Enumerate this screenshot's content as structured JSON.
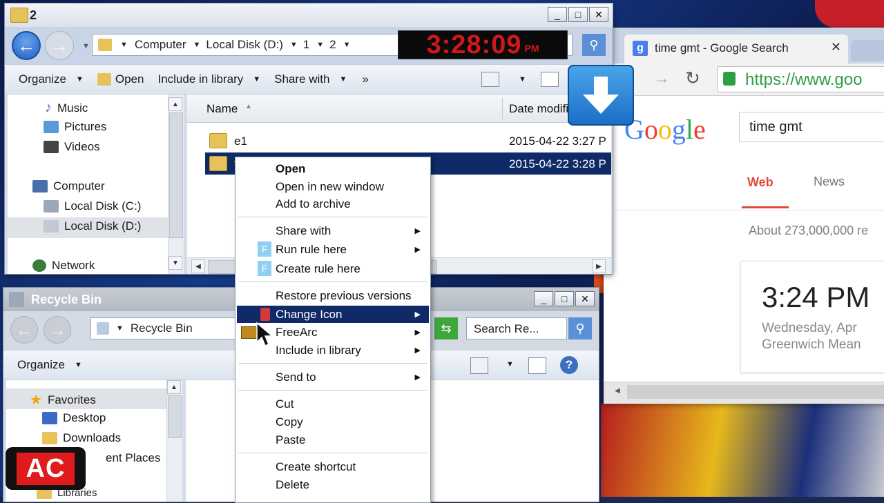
{
  "explorer": {
    "title": "2",
    "breadcrumb": [
      "Computer",
      "Local Disk (D:)",
      "1",
      "2"
    ],
    "commands": [
      "Organize",
      "Open",
      "Include in library",
      "Share with"
    ],
    "more": "»",
    "nav_items": [
      "Music",
      "Pictures",
      "Videos",
      "Computer",
      "Local Disk (C:)",
      "Local Disk (D:)",
      "Network"
    ],
    "columns": {
      "name": "Name",
      "date": "Date modifi"
    },
    "rows": [
      {
        "name": "e1",
        "date": "2015-04-22 3:27 P"
      },
      {
        "name": "t",
        "date": "2015-04-22 3:28 P"
      }
    ]
  },
  "clock": {
    "time": "3:28:09",
    "ampm": "PM"
  },
  "recycle": {
    "title": "Recycle Bin",
    "breadcrumb": "Recycle Bin",
    "search_placeholder": "Search Re...",
    "commands": [
      "Organize"
    ],
    "nav_items": [
      "Favorites",
      "Desktop",
      "Downloads",
      "ent Places",
      "Libraries"
    ]
  },
  "context_menu": {
    "items": [
      "Open",
      "Open in new window",
      "Add to archive",
      "Share with",
      "Run rule here",
      "Create rule here",
      "Restore previous versions",
      "Change Icon",
      "FreeArc",
      "Include in library",
      "Send to",
      "Cut",
      "Copy",
      "Paste",
      "Create shortcut",
      "Delete"
    ],
    "highlighted": "Change Icon"
  },
  "browser": {
    "tab_title": "time gmt - Google Search",
    "url": "https://www.goo",
    "logo": "Google",
    "query": "time gmt",
    "tabs": [
      "Web",
      "News"
    ],
    "results_count": "About 273,000,000 re",
    "time_result": "3:24 PM",
    "date_line": "Wednesday, Apr",
    "tz_line": "Greenwich Mean"
  },
  "badge": {
    "text": "AC"
  },
  "colors": {
    "menu_highlight": "#0f2a66",
    "clock_red": "#d01818",
    "google_red": "#dd4b39",
    "selection": "#0f2a66"
  }
}
